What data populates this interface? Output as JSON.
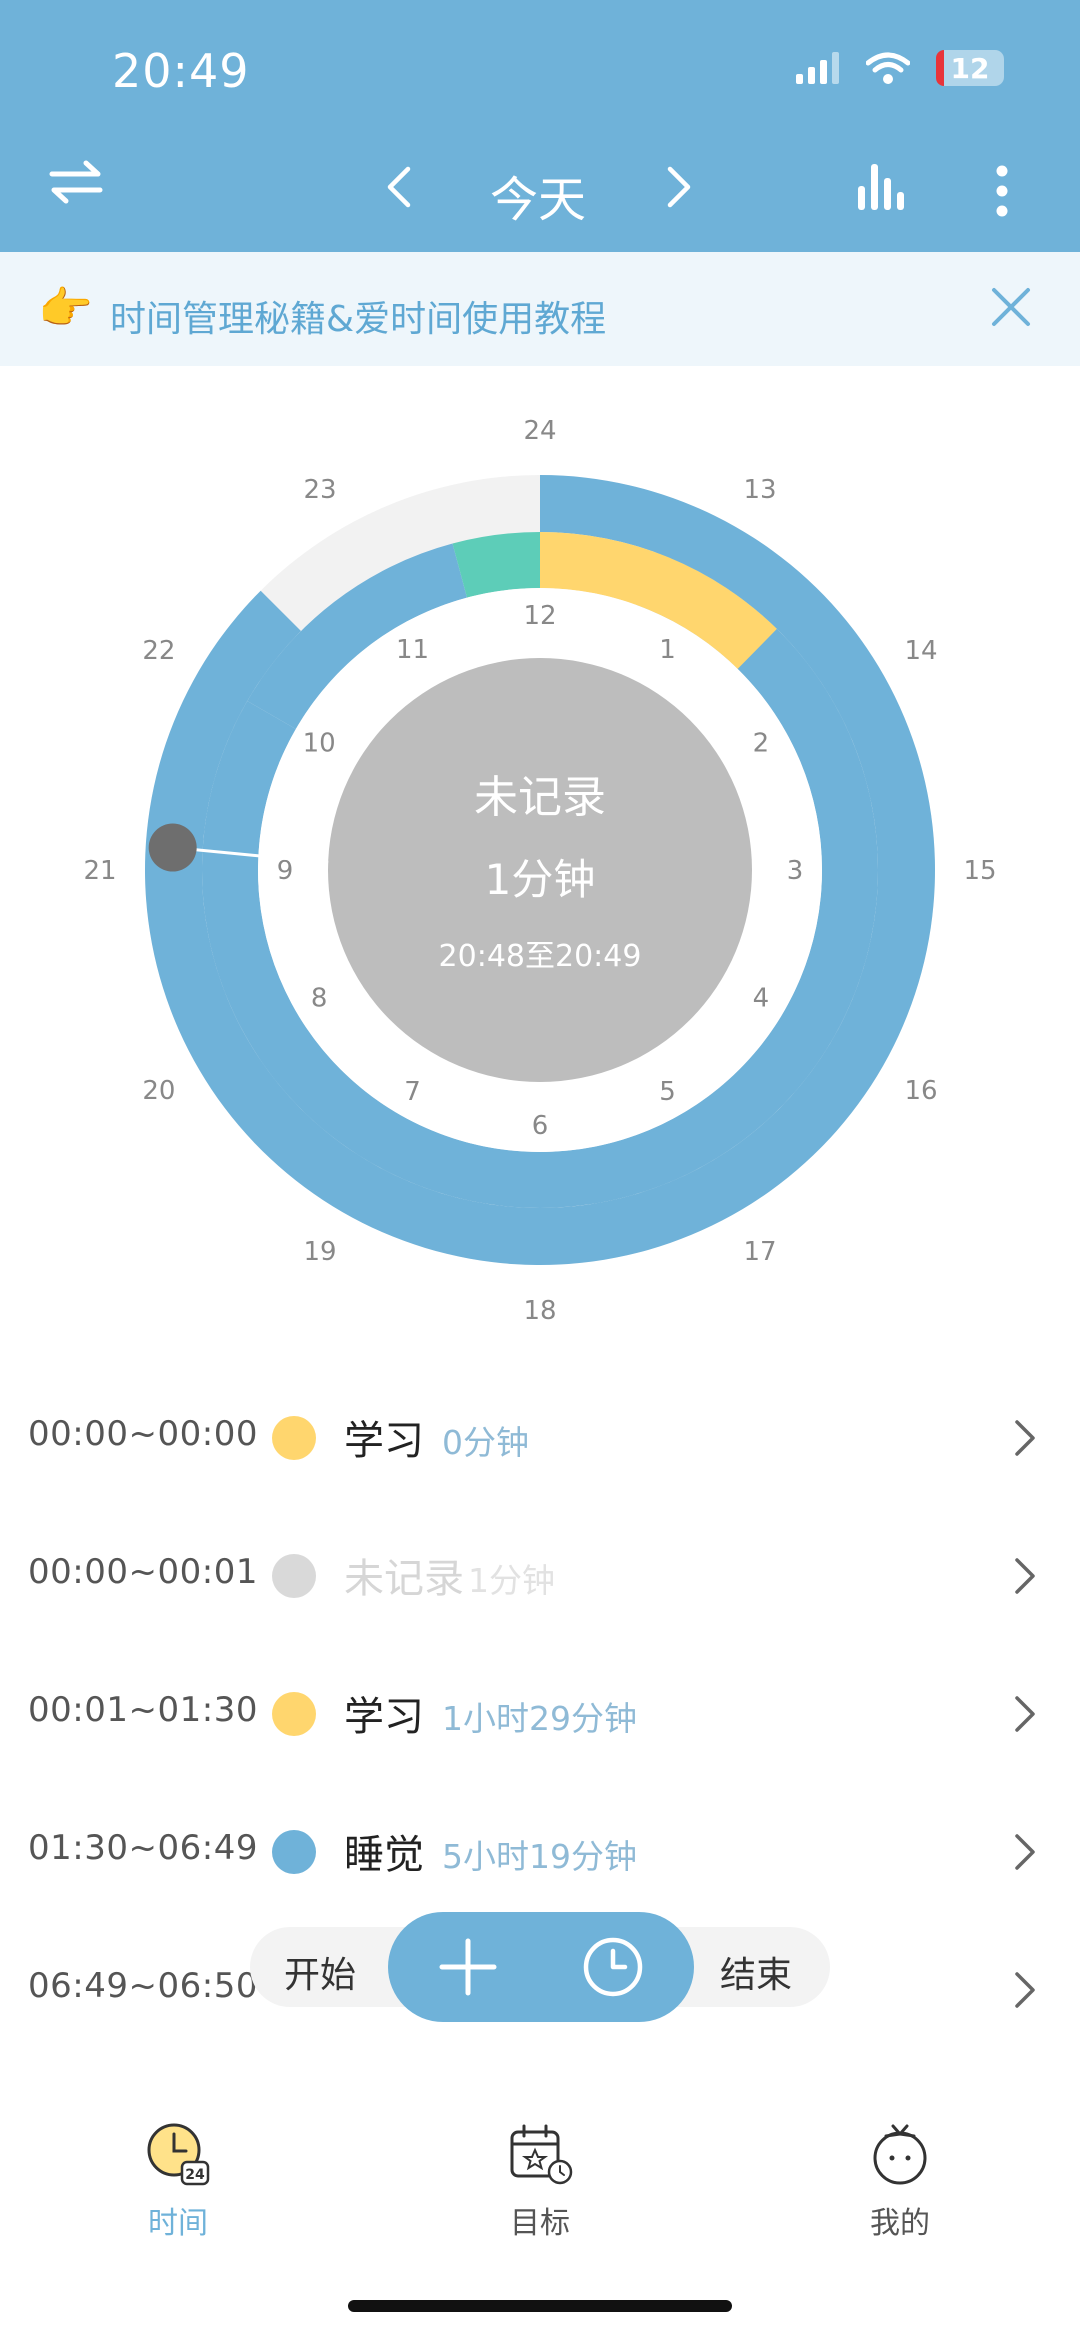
{
  "status": {
    "time": "20:49",
    "battery": "12"
  },
  "nav": {
    "title": "今天"
  },
  "banner": {
    "hand": "👉",
    "text": "时间管理秘籍&爱时间使用教程"
  },
  "clock": {
    "center_title": "未记录",
    "center_duration": "1分钟",
    "center_range": "20:48至20:49",
    "outer_labels": [
      "24",
      "13",
      "14",
      "15",
      "16",
      "17",
      "18",
      "19",
      "20",
      "21",
      "22",
      "23"
    ],
    "inner_labels": [
      "12",
      "1",
      "2",
      "3",
      "4",
      "5",
      "6",
      "7",
      "8",
      "9",
      "10",
      "11"
    ]
  },
  "records": [
    {
      "time": "00:00~00:00",
      "name": "学习",
      "duration": "0分钟",
      "color": "#FFD66E",
      "muted": false
    },
    {
      "time": "00:00~00:01",
      "name": "未记录",
      "duration": "1分钟",
      "color": "#D9D9D9",
      "muted": true
    },
    {
      "time": "00:01~01:30",
      "name": "学习",
      "duration": "1小时29分钟",
      "color": "#FFD66E",
      "muted": false
    },
    {
      "time": "01:30~06:49",
      "name": "睡觉",
      "duration": "5小时19分钟",
      "color": "#6FB2D9",
      "muted": false
    },
    {
      "time": "06:49~06:50",
      "name": "",
      "duration": "",
      "color": "",
      "muted": false
    }
  ],
  "actions": {
    "start": "开始",
    "end": "结束"
  },
  "tabs": [
    {
      "label": "时间",
      "icon": "time-24-icon",
      "active": true
    },
    {
      "label": "目标",
      "icon": "goal-calendar-icon",
      "active": false
    },
    {
      "label": "我的",
      "icon": "tomato-icon",
      "active": false
    }
  ],
  "colors": {
    "primary": "#6FB2D9",
    "study": "#FFD66E",
    "other": "#5DCDB8",
    "unrecorded": "#BDBDBD"
  }
}
